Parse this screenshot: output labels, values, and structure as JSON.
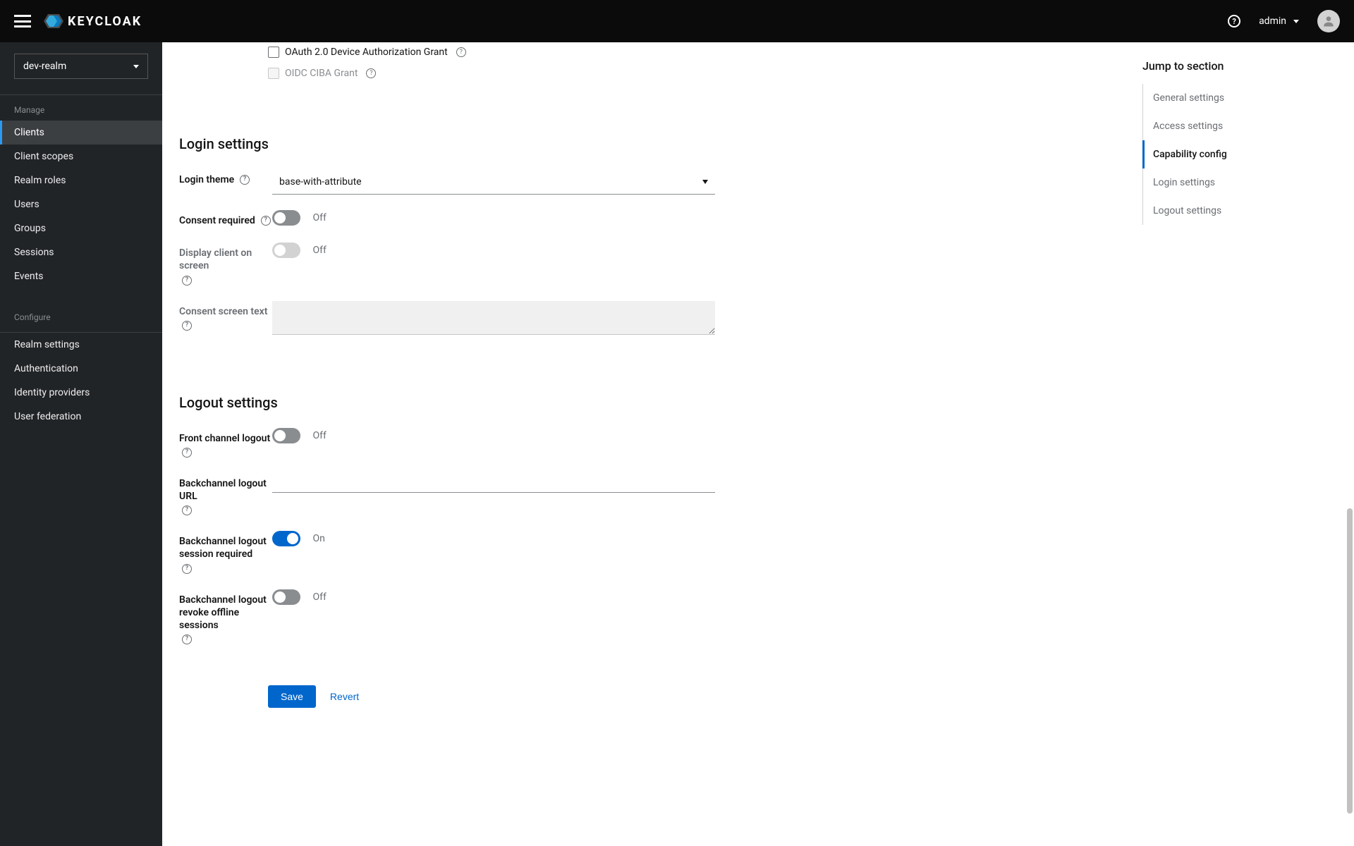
{
  "header": {
    "brand": "KEYCLOAK",
    "user": "admin"
  },
  "sidebar": {
    "realm": "dev-realm",
    "sections": [
      {
        "label": "Manage",
        "items": [
          "Clients",
          "Client scopes",
          "Realm roles",
          "Users",
          "Groups",
          "Sessions",
          "Events"
        ],
        "activeIndex": 0
      },
      {
        "label": "Configure",
        "items": [
          "Realm settings",
          "Authentication",
          "Identity providers",
          "User federation"
        ],
        "activeIndex": -1
      }
    ]
  },
  "capability": {
    "oauth_device_label": "OAuth 2.0 Device Authorization Grant",
    "oidc_ciba_label": "OIDC CIBA Grant"
  },
  "login": {
    "heading": "Login settings",
    "theme_label": "Login theme",
    "theme_value": "base-with-attribute",
    "consent_required_label": "Consent required",
    "consent_required_value": "Off",
    "display_client_label": "Display client on screen",
    "display_client_value": "Off",
    "consent_text_label": "Consent screen text",
    "consent_text_value": ""
  },
  "logout": {
    "heading": "Logout settings",
    "front_channel_label": "Front channel logout",
    "front_channel_value": "Off",
    "backchannel_url_label": "Backchannel logout URL",
    "backchannel_url_value": "",
    "backchannel_session_label": "Backchannel logout session required",
    "backchannel_session_value": "On",
    "backchannel_revoke_label": "Backchannel logout revoke offline sessions",
    "backchannel_revoke_value": "Off"
  },
  "jump": {
    "title": "Jump to section",
    "items": [
      "General settings",
      "Access settings",
      "Capability config",
      "Login settings",
      "Logout settings"
    ],
    "activeIndex": 2
  },
  "actions": {
    "save": "Save",
    "revert": "Revert"
  }
}
